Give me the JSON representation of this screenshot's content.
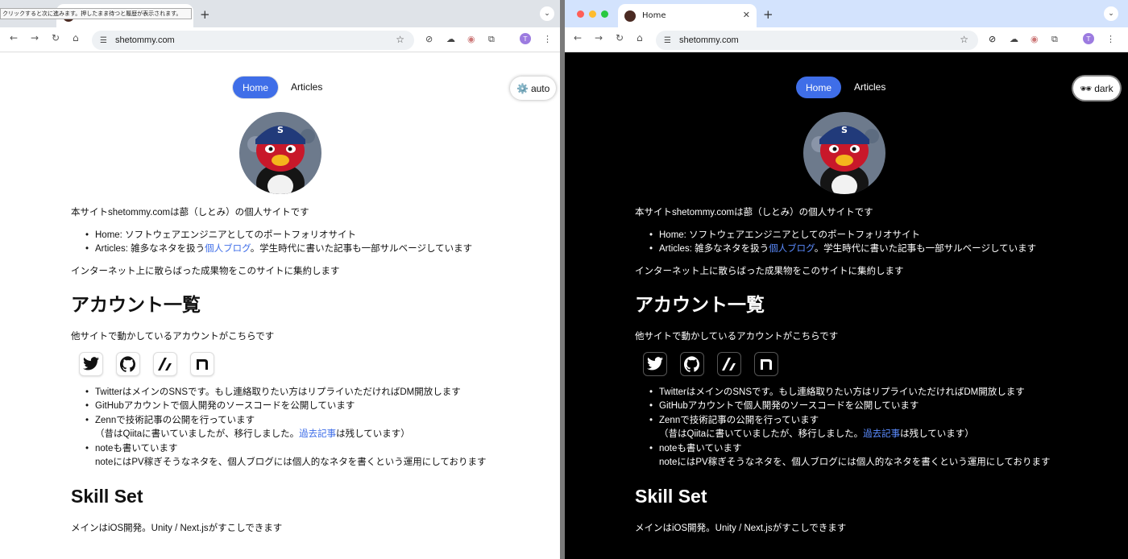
{
  "browser": {
    "tab_title": "Home",
    "tooltip": "クリックすると次に進みます。押したまま待つと履歴が表示されます。",
    "url": "shetommy.com",
    "profile_initial": "T"
  },
  "site": {
    "nav": {
      "home": "Home",
      "articles": "Articles"
    },
    "theme_left": {
      "icon": "⚙️",
      "label": "auto"
    },
    "theme_right": {
      "icon": "🕶",
      "label": "dark"
    },
    "intro": "本サイトshetommy.comは蔀（しとみ）の個人サイトです",
    "intro_list": {
      "home": "Home: ソフトウェアエンジニアとしてのポートフォリオサイト",
      "articles_prefix": "Articles: 雑多なネタを扱う",
      "articles_link": "個人ブログ",
      "articles_suffix": "。学生時代に書いた記事も一部サルベージしています"
    },
    "collect": "インターネット上に散らばった成果物をこのサイトに集約します",
    "accounts_heading": "アカウント一覧",
    "accounts_desc": "他サイトで動かしているアカウントがこちらです",
    "accounts_list": {
      "twitter": "TwitterはメインのSNSです。もし連絡取りたい方はリプライいただければDM開放します",
      "github": "GitHubアカウントで個人開発のソースコードを公開しています",
      "zenn_line1": "Zennで技術記事の公開を行っています",
      "zenn_line2_prefix": "（昔はQiitaに書いていましたが、移行しました。",
      "zenn_line2_link": "過去記事",
      "zenn_line2_suffix": "は残しています）",
      "note_line1": "noteも書いています",
      "note_line2": "noteにはPV稼ぎそうなネタを、個人ブログには個人的なネタを書くという運用にしております"
    },
    "skill_heading": "Skill Set",
    "skill_desc": "メインはiOS開発。Unity / Next.jsがすこしできます"
  },
  "colors": {
    "accent": "#3f6ee8",
    "light_bg": "#ffffff",
    "dark_bg": "#000000"
  }
}
